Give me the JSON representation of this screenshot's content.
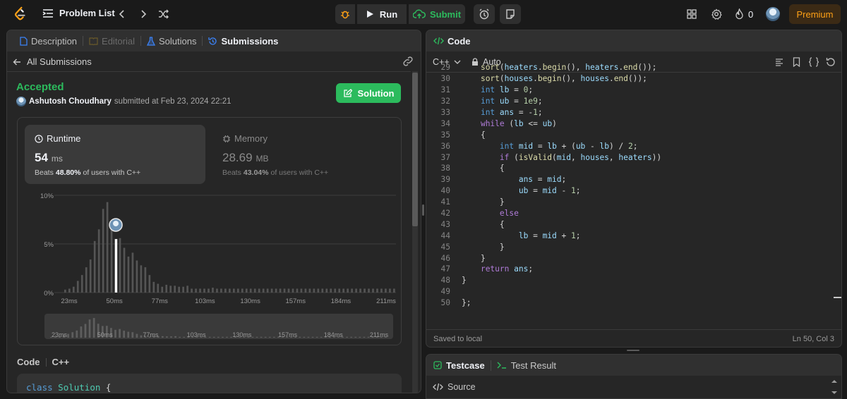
{
  "topbar": {
    "problem_list": "Problem List",
    "run": "Run",
    "submit": "Submit",
    "streak": "0",
    "premium": "Premium"
  },
  "left": {
    "tabs": [
      "Description",
      "Editorial",
      "Solutions",
      "Submissions"
    ],
    "back": "All Submissions",
    "status": "Accepted",
    "user": "Ashutosh Choudhary",
    "submitted": "submitted at Feb 23, 2024 22:21",
    "solution_btn": "Solution",
    "runtime": {
      "label": "Runtime",
      "value": "54",
      "unit": "ms",
      "beats_pre": "Beats",
      "beats": "48.80%",
      "beats_post": "of users with C++"
    },
    "memory": {
      "label": "Memory",
      "value": "28.69",
      "unit": "MB",
      "beats_pre": "Beats",
      "beats": "43.04%",
      "beats_post": "of users with C++"
    },
    "code_label": "Code",
    "code_lang": "C++",
    "code_preview": [
      "class",
      "Solution",
      "{"
    ]
  },
  "chart_data": {
    "type": "bar",
    "x_ticks": [
      "23ms",
      "50ms",
      "77ms",
      "103ms",
      "130ms",
      "157ms",
      "184ms",
      "211ms"
    ],
    "y_ticks": [
      "10%",
      "5%",
      "0%"
    ],
    "ylim": [
      0,
      10
    ],
    "highlight_index": 12,
    "values": [
      0.3,
      0.4,
      0.6,
      1.2,
      1.8,
      2.6,
      3.4,
      5.3,
      6.5,
      8.6,
      9.3,
      6.6,
      5.5,
      5.6,
      4.6,
      3.7,
      4.1,
      3.3,
      2.8,
      2.6,
      1.8,
      1.1,
      0.9,
      0.6,
      0.8,
      0.7,
      0.7,
      0.6,
      0.6,
      0.7,
      0.4,
      0.4,
      0.4,
      0.4,
      0.4,
      0.5,
      0.4,
      0.4,
      0.4,
      0.4,
      0.4,
      0.4,
      0.4,
      0.4,
      0.4,
      0.4,
      0.4,
      0.4,
      0.4,
      0.4,
      0.4,
      0.4,
      0.4,
      0.4,
      0.4,
      0.4,
      0.4,
      0.4,
      0.4,
      0.4,
      0.4,
      0.4,
      0.4,
      0.4,
      0.4,
      0.4,
      0.4,
      0.4,
      0.4,
      0.4,
      0.4,
      0.4,
      0.4,
      0.4,
      0.4,
      0.4,
      0.4,
      0.4,
      0.4
    ]
  },
  "editor": {
    "title": "Code",
    "lang": "C++",
    "mode": "Auto",
    "status_left": "Saved to local",
    "status_right": "Ln 50, Col 3",
    "lines": [
      {
        "n": "29",
        "t": "    sort(heaters.begin(), heaters.end());"
      },
      {
        "n": "30",
        "t": "    sort(houses.begin(), houses.end());"
      },
      {
        "n": "31",
        "t": "    int lb = 0;"
      },
      {
        "n": "32",
        "t": "    int ub = 1e9;"
      },
      {
        "n": "33",
        "t": "    int ans = -1;"
      },
      {
        "n": "34",
        "t": "    while (lb <= ub)"
      },
      {
        "n": "35",
        "t": "    {"
      },
      {
        "n": "36",
        "t": "        int mid = lb + (ub - lb) / 2;"
      },
      {
        "n": "37",
        "t": "        if (isValid(mid, houses, heaters))"
      },
      {
        "n": "38",
        "t": "        {"
      },
      {
        "n": "39",
        "t": "            ans = mid;"
      },
      {
        "n": "40",
        "t": "            ub = mid - 1;"
      },
      {
        "n": "41",
        "t": "        }"
      },
      {
        "n": "42",
        "t": "        else"
      },
      {
        "n": "43",
        "t": "        {"
      },
      {
        "n": "44",
        "t": "            lb = mid + 1;"
      },
      {
        "n": "45",
        "t": "        }"
      },
      {
        "n": "46",
        "t": "    }"
      },
      {
        "n": "47",
        "t": "    return ans;"
      },
      {
        "n": "48",
        "t": "}"
      },
      {
        "n": "49",
        "t": ""
      },
      {
        "n": "50",
        "t": "};"
      }
    ]
  },
  "bottom": {
    "testcase": "Testcase",
    "test_result": "Test Result",
    "source": "Source"
  },
  "colors": {
    "accent_green": "#2cbb5d",
    "premium": "#ffa116",
    "bg": "#1a1a1a",
    "panel": "#262626"
  }
}
